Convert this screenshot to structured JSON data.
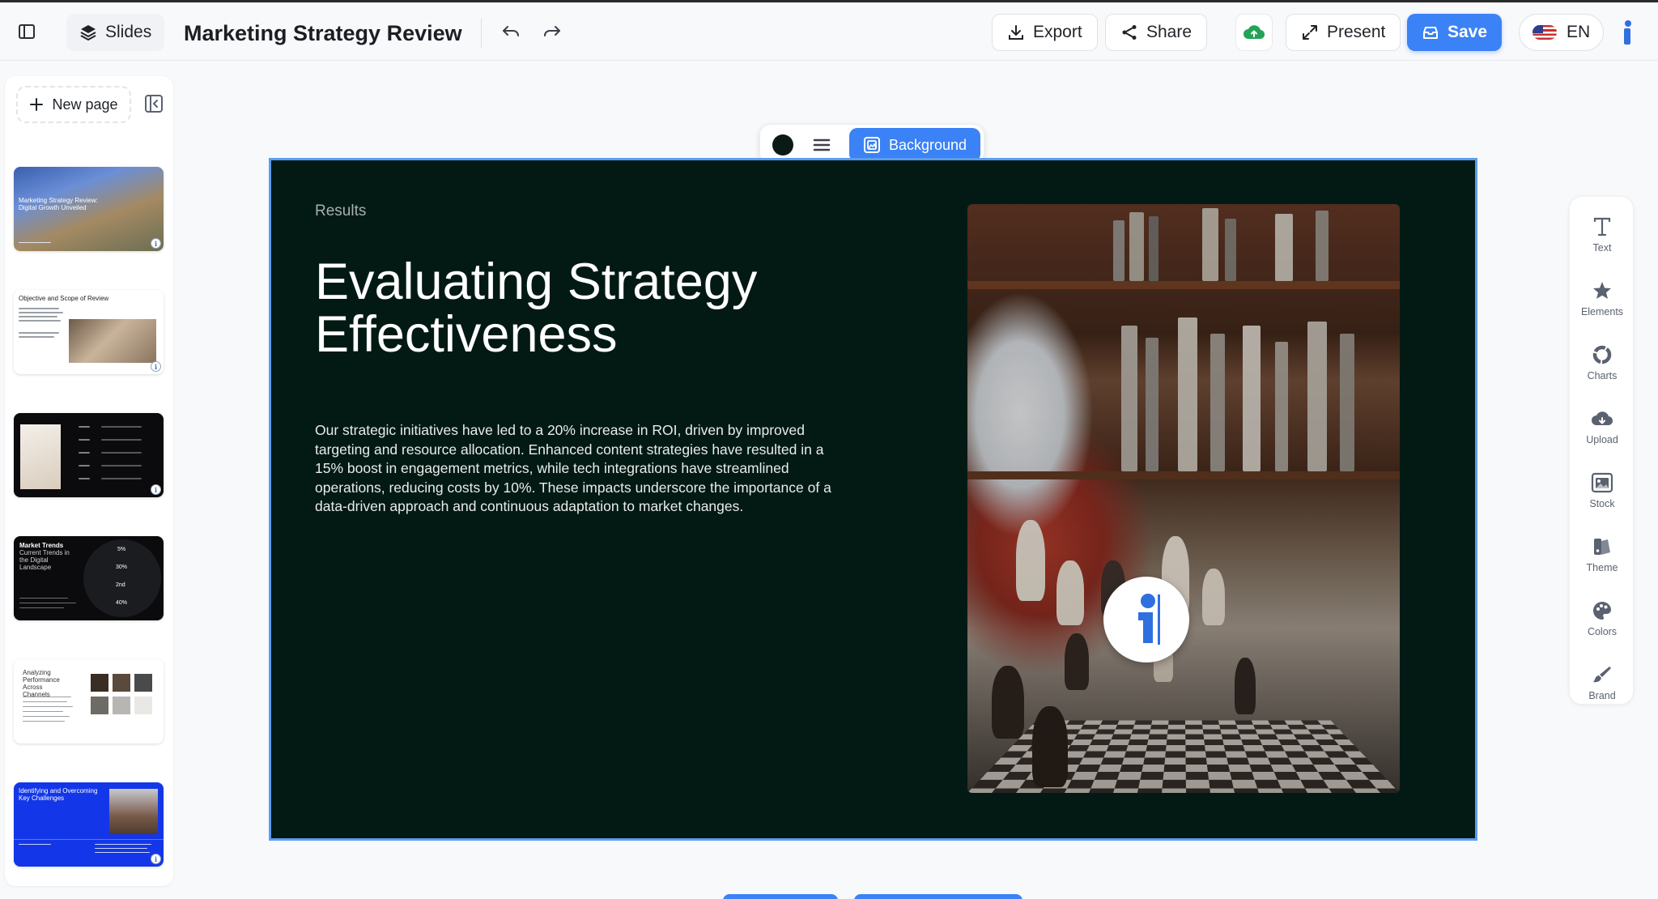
{
  "app": {
    "slides_label": "Slides",
    "doc_title": "Marketing Strategy Review"
  },
  "toolbar": {
    "export_label": "Export",
    "share_label": "Share",
    "present_label": "Present",
    "save_label": "Save",
    "language": "EN"
  },
  "sidebar": {
    "new_page_label": "New page",
    "thumbnails": [
      {
        "title": "Marketing Strategy Review: Digital Growth Unveiled"
      },
      {
        "title": "Objective and Scope of Review"
      },
      {
        "title": ""
      },
      {
        "title": "Market Trends",
        "subtitle": "Current Trends in the Digital Landscape",
        "stats": [
          "5%",
          "30%",
          "2nd",
          "40%"
        ]
      },
      {
        "title": "Analyzing Performance Across Channels"
      },
      {
        "title": "Identifying and Overcoming Key Challenges"
      }
    ]
  },
  "float_toolbar": {
    "background_label": "Background",
    "color": "#0c1a15"
  },
  "slide": {
    "label": "Results",
    "title": "Evaluating Strategy Effectiveness",
    "body": "Our strategic initiatives have led to a 20% increase in ROI, driven by improved targeting and resource allocation. Enhanced content strategies have resulted in a 15% boost in engagement metrics, while tech integrations have streamlined operations, reducing costs by 10%. These impacts underscore the importance of a data-driven approach and continuous adaptation to market changes.",
    "background_color": "#031a14"
  },
  "tools": [
    {
      "label": "Text",
      "icon": "text-icon"
    },
    {
      "label": "Elements",
      "icon": "star-icon"
    },
    {
      "label": "Charts",
      "icon": "chart-icon"
    },
    {
      "label": "Upload",
      "icon": "cloud-upload-icon"
    },
    {
      "label": "Stock",
      "icon": "image-icon"
    },
    {
      "label": "Theme",
      "icon": "theme-icon"
    },
    {
      "label": "Colors",
      "icon": "palette-icon"
    },
    {
      "label": "Brand",
      "icon": "brush-icon"
    }
  ],
  "colors": {
    "accent": "#3b82f6",
    "slide_bg": "#031a14",
    "cloud_green": "#22a355"
  }
}
